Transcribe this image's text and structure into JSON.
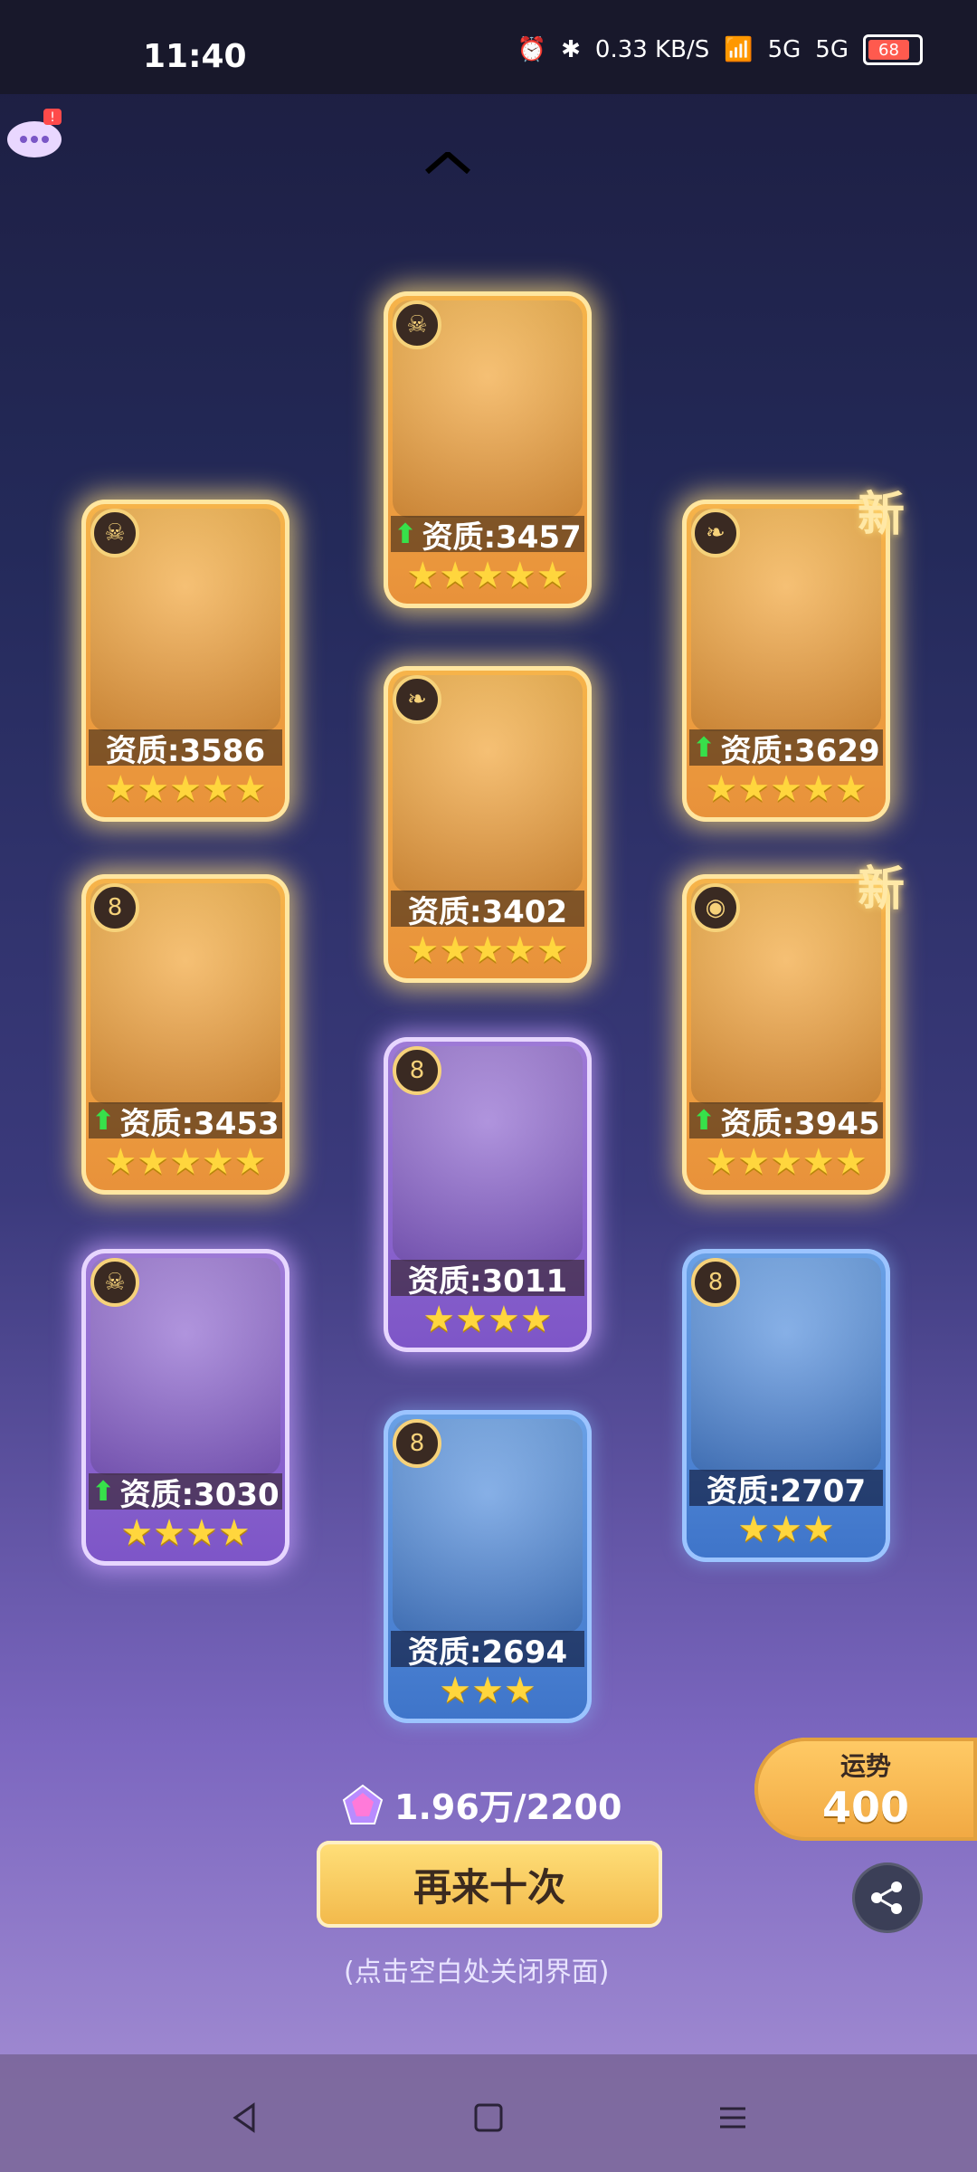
{
  "status_bar": {
    "time": "11:40",
    "network_speed": "0.33\nKB/S",
    "signal1": "5G",
    "signal2": "5G",
    "battery": "68"
  },
  "cards": [
    {
      "rarity": "gold",
      "quality_label": "资质:3586",
      "stars": "★★★★★",
      "improved": false,
      "new": false
    },
    {
      "rarity": "gold",
      "quality_label": "资质:3457",
      "stars": "★★★★★",
      "improved": true,
      "new": false
    },
    {
      "rarity": "gold",
      "quality_label": "资质:3629",
      "stars": "★★★★★",
      "improved": true,
      "new": true,
      "new_label": "新"
    },
    {
      "rarity": "gold",
      "quality_label": "资质:3453",
      "stars": "★★★★★",
      "improved": true,
      "new": false
    },
    {
      "rarity": "gold",
      "quality_label": "资质:3402",
      "stars": "★★★★★",
      "improved": false,
      "new": false
    },
    {
      "rarity": "gold",
      "quality_label": "资质:3945",
      "stars": "★★★★★",
      "improved": true,
      "new": true,
      "new_label": "新"
    },
    {
      "rarity": "purple",
      "quality_label": "资质:3030",
      "stars": "★★★★",
      "improved": true,
      "new": false
    },
    {
      "rarity": "purple",
      "quality_label": "资质:3011",
      "stars": "★★★★",
      "improved": false,
      "new": false
    },
    {
      "rarity": "blue",
      "quality_label": "资质:2707",
      "stars": "★★★",
      "improved": false,
      "new": false
    },
    {
      "rarity": "blue",
      "quality_label": "资质:2694",
      "stars": "★★★",
      "improved": false,
      "new": false
    }
  ],
  "luck": {
    "label": "运势",
    "value": "400"
  },
  "cost": {
    "text": "1.96万/2200"
  },
  "buttons": {
    "again": "再来十次"
  },
  "hint": "(点击空白处关闭界面)",
  "icons": {
    "chat": "chat-icon",
    "share": "share-icon",
    "back": "back-nav-icon",
    "home": "home-nav-icon",
    "menu": "menu-nav-icon"
  },
  "colors": {
    "gold_card": "#f6b44a",
    "purple_card": "#9e7ad6",
    "blue_card": "#6aa1e6",
    "button": "#ffe07a"
  }
}
